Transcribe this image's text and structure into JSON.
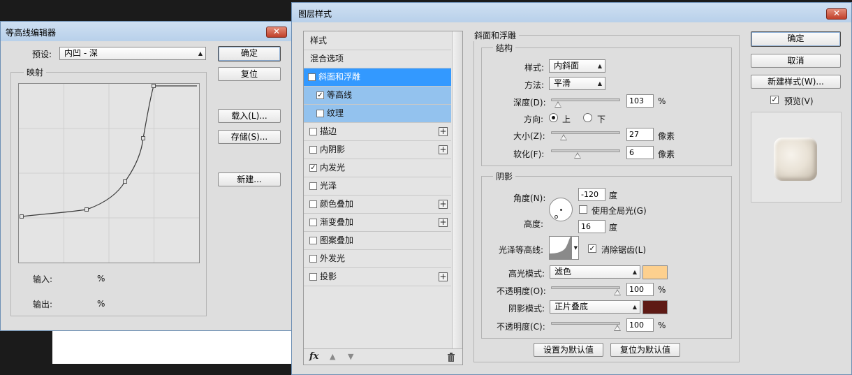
{
  "contour_editor": {
    "title": "等高线编辑器",
    "close_label": "✕",
    "preset_label": "预设:",
    "preset_value": "内凹 - 深",
    "mapping_label": "映射",
    "input_label": "输入:",
    "output_label": "输出:",
    "percent": "%",
    "ok": "确定",
    "reset": "复位",
    "load": "载入(L)...",
    "save": "存储(S)...",
    "new": "新建..."
  },
  "layer_style": {
    "title": "图层样式",
    "close_label": "✕",
    "list_header": "样式",
    "blend_options": "混合选项",
    "items": [
      {
        "label": "斜面和浮雕",
        "checked": "✓",
        "plus": ""
      },
      {
        "label": "等高线",
        "checked": "✓",
        "plus": ""
      },
      {
        "label": "纹理",
        "checked": "",
        "plus": ""
      },
      {
        "label": "描边",
        "checked": "",
        "plus": "+"
      },
      {
        "label": "内阴影",
        "checked": "",
        "plus": "+"
      },
      {
        "label": "内发光",
        "checked": "✓",
        "plus": ""
      },
      {
        "label": "光泽",
        "checked": "",
        "plus": ""
      },
      {
        "label": "颜色叠加",
        "checked": "",
        "plus": "+"
      },
      {
        "label": "渐变叠加",
        "checked": "",
        "plus": "+"
      },
      {
        "label": "图案叠加",
        "checked": "",
        "plus": ""
      },
      {
        "label": "外发光",
        "checked": "",
        "plus": ""
      },
      {
        "label": "投影",
        "checked": "",
        "plus": "+"
      }
    ],
    "fx_label": "fx",
    "bevel": {
      "section_title": "斜面和浮雕",
      "structure_title": "结构",
      "style_label": "样式:",
      "style_value": "内斜面",
      "technique_label": "方法:",
      "technique_value": "平滑",
      "depth_label": "深度(D):",
      "depth_value": "103",
      "depth_unit": "%",
      "direction_label": "方向:",
      "dir_up": "上",
      "dir_down": "下",
      "size_label": "大小(Z):",
      "size_value": "27",
      "size_unit": "像素",
      "soften_label": "软化(F):",
      "soften_value": "6",
      "soften_unit": "像素"
    },
    "shading": {
      "title": "阴影",
      "angle_label": "角度(N):",
      "angle_value": "-120",
      "angle_unit": "度",
      "global_light_label": "使用全局光(G)",
      "altitude_label": "高度:",
      "altitude_value": "16",
      "altitude_unit": "度",
      "gloss_contour_label": "光泽等高线:",
      "antialias_label": "消除锯齿(L)",
      "highlight_mode_label": "高光模式:",
      "highlight_mode_value": "滤色",
      "highlight_color": "#fdd08e",
      "opacity1_label": "不透明度(O):",
      "opacity1_value": "100",
      "shadow_mode_label": "阴影模式:",
      "shadow_mode_value": "正片叠底",
      "shadow_color": "#5e1a15",
      "opacity2_label": "不透明度(C):",
      "opacity2_value": "100",
      "percent": "%"
    },
    "make_default": "设置为默认值",
    "reset_default": "复位为默认值",
    "ok": "确定",
    "cancel": "取消",
    "new_style": "新建样式(W)...",
    "preview_label": "预览(V)"
  }
}
